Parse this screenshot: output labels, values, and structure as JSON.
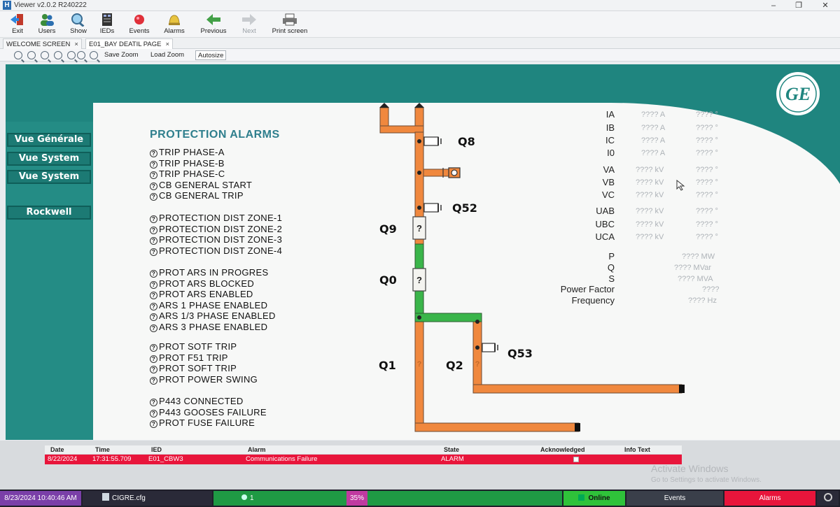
{
  "window": {
    "title": "Viewer v2.0.2 R240222",
    "glyph": "H",
    "controls": [
      "–",
      "❐",
      "✕"
    ]
  },
  "toolbar": {
    "buttons": [
      {
        "label": "Exit",
        "icon": "exit-icon"
      },
      {
        "label": "Users",
        "icon": "users-icon"
      },
      {
        "label": "Show",
        "icon": "show-icon"
      },
      {
        "label": "IEDs",
        "icon": "ieds-icon"
      },
      {
        "label": "Events",
        "icon": "events-icon"
      },
      {
        "label": "Alarms",
        "icon": "alarms-icon"
      },
      {
        "label": "Previous",
        "icon": "previous-arrow-icon"
      },
      {
        "label": "Next",
        "icon": "next-arrow-icon"
      },
      {
        "label": "Print screen",
        "icon": "printer-icon"
      }
    ]
  },
  "tabs": [
    {
      "label": "WELCOME SCREEN",
      "close": "×"
    },
    {
      "label": "E01_BAY DEATIL PAGE",
      "close": "×"
    }
  ],
  "zoom": {
    "save": "Save Zoom",
    "load": "Load Zoom",
    "autosize": "Autosize"
  },
  "nav": {
    "buttons": [
      "Vue Générale",
      "Vue System",
      "Vue System",
      "Rockwell"
    ]
  },
  "logo": {
    "text": "GE"
  },
  "alarms": {
    "title": "PROTECTION ALARMS",
    "icon_glyph": "?",
    "items": [
      "TRIP PHASE-A",
      "TRIP PHASE-B",
      "TRIP PHASE-C",
      "CB GENERAL START",
      "CB GENERAL TRIP",
      "PROTECTION DIST ZONE-1",
      "PROTECTION DIST ZONE-2",
      "PROTECTION DIST ZONE-3",
      "PROTECTION DIST ZONE-4",
      "PROT ARS IN PROGRES",
      "PROT ARS BLOCKED",
      "PROT ARS ENABLED",
      "ARS 1 PHASE ENABLED",
      "ARS 1/3 PHASE ENABLED",
      "ARS 3 PHASE ENABLED",
      "PROT SOTF TRIP",
      "PROT F51 TRIP",
      "PROT SOFT TRIP",
      "PROT POWER SWING",
      "P443 CONNECTED",
      "P443 GOOSES FAILURE",
      "PROT FUSE FAILURE"
    ]
  },
  "switches": {
    "q8": "Q8",
    "q52": "Q52",
    "q9": "Q9",
    "q0": "Q0",
    "q53": "Q53",
    "q1": "Q1",
    "q2": "Q2",
    "unknown_glyph": "?"
  },
  "colors": {
    "energized": "#3ab54a",
    "deenergized": "#f0883e",
    "teal": "#1f857f",
    "alarm_red": "#e8153b"
  },
  "measurements": {
    "rows": [
      {
        "label": "IA",
        "value": "???? A",
        "angle": "???? °"
      },
      {
        "label": "IB",
        "value": "???? A",
        "angle": "???? °"
      },
      {
        "label": "IC",
        "value": "???? A",
        "angle": "???? °"
      },
      {
        "label": "I0",
        "value": "???? A",
        "angle": "???? °"
      },
      {
        "label": "VA",
        "value": "???? kV",
        "angle": "???? °"
      },
      {
        "label": "VB",
        "value": "???? kV",
        "angle": "???? °"
      },
      {
        "label": "VC",
        "value": "???? kV",
        "angle": "???? °"
      },
      {
        "label": "UAB",
        "value": "???? kV",
        "angle": "???? °"
      },
      {
        "label": "UBC",
        "value": "???? kV",
        "angle": "???? °"
      },
      {
        "label": "UCA",
        "value": "???? kV",
        "angle": "???? °"
      }
    ],
    "power": [
      {
        "label": "P",
        "value": "???? MW"
      },
      {
        "label": "Q",
        "value": "???? MVar"
      },
      {
        "label": "S",
        "value": "???? MVA"
      },
      {
        "label": "Power Factor",
        "value": "????"
      },
      {
        "label": "Frequency",
        "value": "???? Hz"
      }
    ]
  },
  "alarm_table": {
    "headers": {
      "date": "Date",
      "time": "Time",
      "ied": "IED",
      "alarm": "Alarm",
      "state": "State",
      "ack": "Acknowledged",
      "info": "Info Text"
    },
    "rows": [
      {
        "date": "8/22/2024",
        "time": "17:31:55.709",
        "ied": "E01_CBW3",
        "alarm": "Communications Failure",
        "state": "ALARM",
        "info": ""
      }
    ]
  },
  "watermark": {
    "line1": "Activate Windows",
    "line2": "Go to Settings to activate Windows."
  },
  "statusbar": {
    "datetime": "8/23/2024 10:40:46 AM",
    "config": "CIGRE.cfg",
    "users": "1",
    "cpu": "35%",
    "online": "Online",
    "events": "Events",
    "alarms": "Alarms"
  }
}
